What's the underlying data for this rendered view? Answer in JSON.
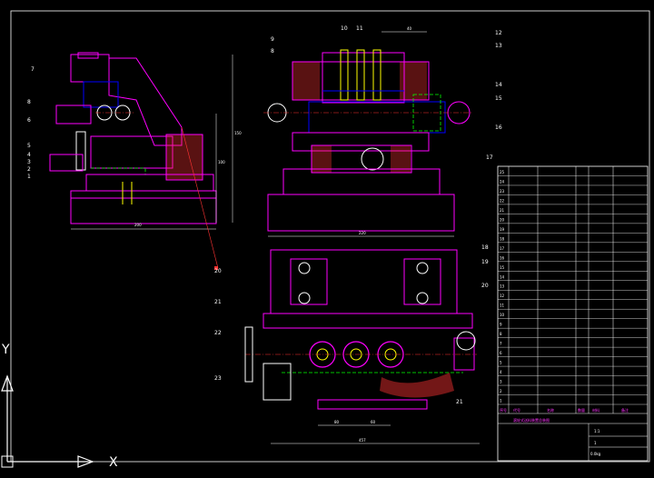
{
  "view": {
    "title": "",
    "colors": {
      "background": "#000000",
      "frame": "#ffffff",
      "outline": "#ff00ff",
      "hidden": "#00ff00",
      "center": "#ff3333",
      "fastener": "#ffff00",
      "spindle": "#0000ff",
      "hatch": "#ff3333"
    }
  },
  "ucs": {
    "x_label": "X",
    "y_label": "Y"
  },
  "callouts": {
    "left_view": [
      "7",
      "8",
      "6",
      "5",
      "4",
      "3",
      "2",
      "1"
    ],
    "top_view": [
      "9",
      "8",
      "10",
      "11",
      "12",
      "13",
      "14",
      "15",
      "16",
      "17"
    ],
    "front_view": [
      "18",
      "19",
      "20",
      "21",
      "22",
      "23",
      "21"
    ],
    "leader_tail": "20"
  },
  "dimensions": {
    "left_width": "200",
    "left_height": "150",
    "left_height2": "100",
    "top_width": "220",
    "top_span": "60",
    "front_a": "80",
    "front_b": "60",
    "front_overall": "457",
    "top_label": "40"
  },
  "title_block": {
    "item_numbers": [
      "25",
      "24",
      "23",
      "22",
      "21",
      "20",
      "19",
      "18",
      "17",
      "16",
      "15",
      "14",
      "13",
      "12",
      "11",
      "10",
      "9",
      "8",
      "7",
      "6",
      "5",
      "4",
      "3",
      "2",
      "1"
    ],
    "header": [
      "序号",
      "代号",
      "名称",
      "数量",
      "材料",
      "备注"
    ],
    "drawing_name": "滚轮式送料装置总装图",
    "scale": "1:1",
    "sheet": "1",
    "weight": "0.0kg"
  }
}
